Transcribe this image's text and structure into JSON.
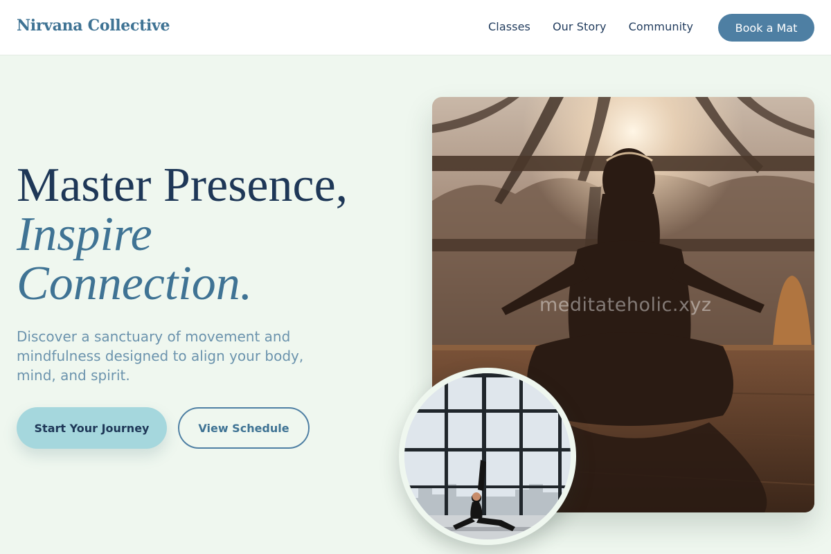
{
  "header": {
    "brand": "Nirvana Collective",
    "nav": [
      "Classes",
      "Our Story",
      "Community"
    ],
    "cta": "Book a Mat"
  },
  "hero": {
    "headline_line1": "Master Presence,",
    "headline_line2": "Inspire",
    "headline_line3": "Connection.",
    "subtitle": "Discover a sanctuary of movement and mindfulness designed to align your body, mind, and spirit.",
    "primary_button": "Start Your Journey",
    "secondary_button": "View Schedule"
  },
  "images": {
    "watermark": "meditateholic.xyz"
  },
  "colors": {
    "page_background": "#eff7ef",
    "heading": "#1e3757",
    "accent": "#3f7394",
    "button_primary": "#a5d7dd",
    "button_nav": "#4e7fa3"
  }
}
